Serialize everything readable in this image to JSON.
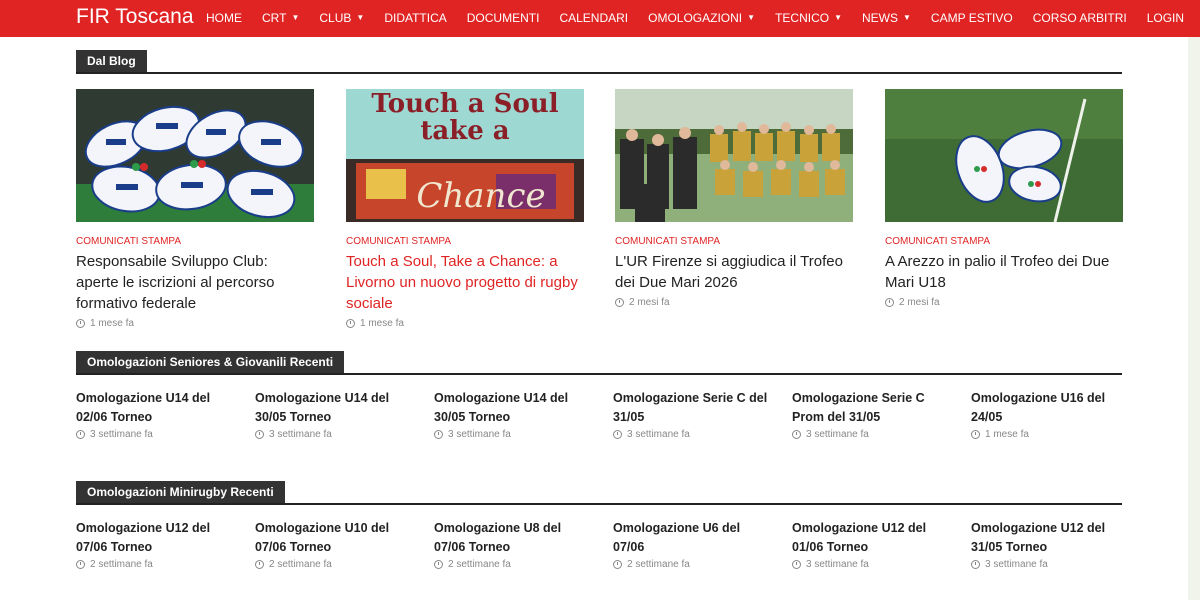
{
  "site": {
    "brand": "FIR Toscana"
  },
  "nav": [
    {
      "label": "HOME",
      "caret": false
    },
    {
      "label": "CRT",
      "caret": true
    },
    {
      "label": "CLUB",
      "caret": true
    },
    {
      "label": "DIDATTICA",
      "caret": false
    },
    {
      "label": "DOCUMENTI",
      "caret": false
    },
    {
      "label": "CALENDARI",
      "caret": false
    },
    {
      "label": "OMOLOGAZIONI",
      "caret": true
    },
    {
      "label": "TECNICO",
      "caret": true
    },
    {
      "label": "NEWS",
      "caret": true
    },
    {
      "label": "CAMP ESTIVO",
      "caret": false
    },
    {
      "label": "CORSO ARBITRI",
      "caret": false
    },
    {
      "label": "LOGIN",
      "caret": false
    }
  ],
  "colors": {
    "accent": "#e02424",
    "section_bg": "#333333"
  },
  "blog": {
    "heading": "Dal Blog",
    "posts": [
      {
        "category": "COMUNICATI STAMPA",
        "title": "Responsabile Sviluppo Club: aperte le iscrizioni al percorso formativo federale",
        "time": "1 mese fa",
        "image": "rugby-balls-pile"
      },
      {
        "category": "COMUNICATI STAMPA",
        "title": "Touch a Soul, Take a Chance: a Livorno un nuovo progetto di rugby sociale",
        "time": "1 mese fa",
        "image": "touch-a-soul-poster",
        "thumb_text": "Touch a Soul take a",
        "graffiti": "Chance"
      },
      {
        "category": "COMUNICATI STAMPA",
        "title": "L'UR Firenze si aggiudica il Trofeo dei Due Mari 2026",
        "time": "2 mesi fa",
        "image": "team-photo"
      },
      {
        "category": "COMUNICATI STAMPA",
        "title": "A Arezzo in palio il Trofeo dei Due Mari U18",
        "time": "2 mesi fa",
        "image": "rugby-balls-grass"
      }
    ]
  },
  "seniores": {
    "heading": "Omologazioni Seniores & Giovanili Recenti",
    "items": [
      {
        "title": "Omologazione U14 del 02/06 Torneo",
        "time": "3 settimane fa"
      },
      {
        "title": "Omologazione U14 del 30/05 Torneo",
        "time": "3 settimane fa"
      },
      {
        "title": "Omologazione U14 del 30/05 Torneo",
        "time": "3 settimane fa"
      },
      {
        "title": "Omologazione Serie C del 31/05",
        "time": "3 settimane fa"
      },
      {
        "title": "Omologazione Serie C Prom del 31/05",
        "time": "3 settimane fa"
      },
      {
        "title": "Omologazione U16 del 24/05",
        "time": "1 mese fa"
      }
    ]
  },
  "minirugby": {
    "heading": "Omologazioni Minirugby Recenti",
    "items": [
      {
        "title": "Omologazione U12 del 07/06 Torneo",
        "time": "2 settimane fa"
      },
      {
        "title": "Omologazione U10 del 07/06 Torneo",
        "time": "2 settimane fa"
      },
      {
        "title": "Omologazione U8 del 07/06 Torneo",
        "time": "2 settimane fa"
      },
      {
        "title": "Omologazione U6 del 07/06",
        "time": "2 settimane fa"
      },
      {
        "title": "Omologazione U12 del 01/06 Torneo",
        "time": "3 settimane fa"
      },
      {
        "title": "Omologazione U12 del 31/05 Torneo",
        "time": "3 settimane fa"
      }
    ]
  }
}
